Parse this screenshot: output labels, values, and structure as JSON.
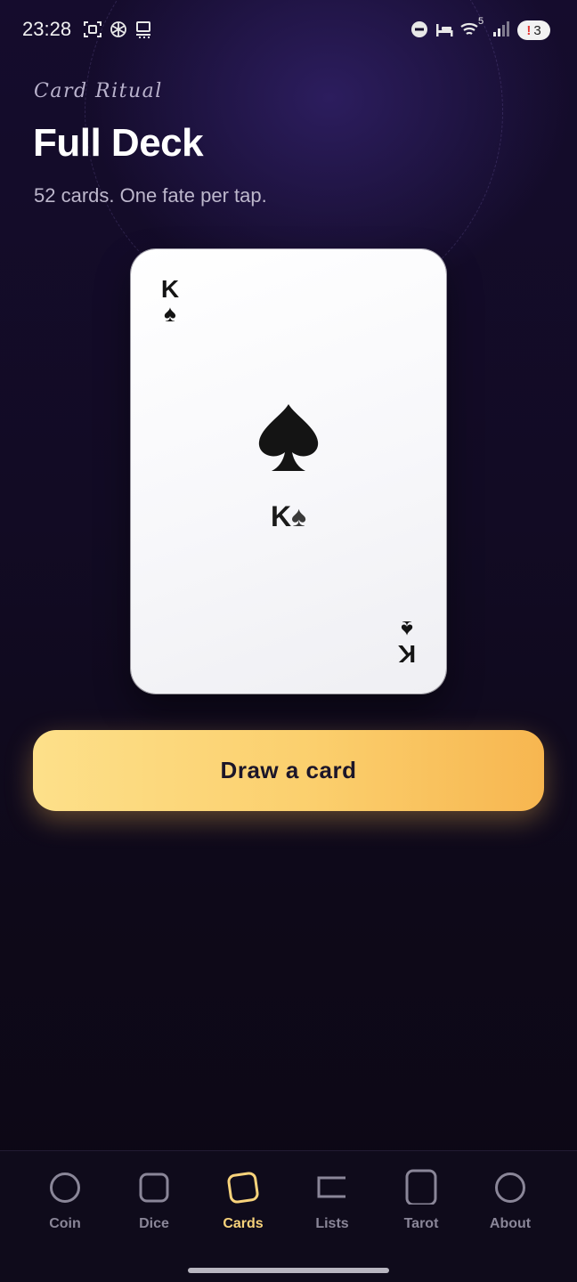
{
  "status_bar": {
    "time": "23:28",
    "left_icons": [
      "screenshot-icon",
      "openai-icon",
      "cast-icon"
    ],
    "right_icons": [
      "dnd-icon",
      "bed-icon",
      "wifi-icon",
      "signal-icon"
    ],
    "wifi_label": "5",
    "notification_count": "3"
  },
  "header": {
    "eyebrow": "Card Ritual",
    "title": "Full Deck",
    "subtitle": "52 cards. One fate per tap."
  },
  "card": {
    "rank": "K",
    "suit_symbol": "♠",
    "center_label_rank": "K",
    "center_label_suit": "♠"
  },
  "action": {
    "draw_label": "Draw a card"
  },
  "nav": {
    "items": [
      {
        "label": "Coin",
        "icon": "coin-icon"
      },
      {
        "label": "Dice",
        "icon": "dice-icon"
      },
      {
        "label": "Cards",
        "icon": "cards-icon",
        "active": true
      },
      {
        "label": "Lists",
        "icon": "lists-icon"
      },
      {
        "label": "Tarot",
        "icon": "tarot-icon"
      },
      {
        "label": "About",
        "icon": "about-icon"
      }
    ]
  },
  "colors": {
    "accent": "#f8d37b",
    "button_start": "#fde08a",
    "button_end": "#f7b650",
    "background": "#120b24"
  }
}
